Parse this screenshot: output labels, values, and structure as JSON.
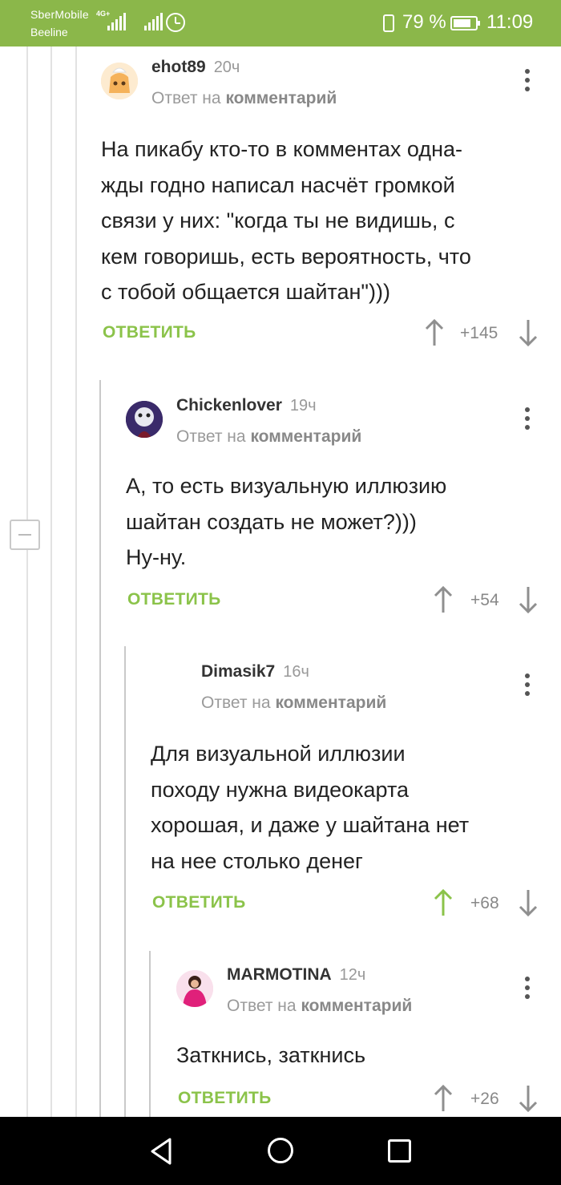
{
  "status_bar": {
    "carrier_primary": "SberMobile",
    "carrier_secondary": "Beeline",
    "network_type": "4G+",
    "battery_percent": "79 %",
    "battery_level": 0.79,
    "time": "11:09",
    "icons": [
      "signal-icon",
      "signal-icon",
      "alarm-icon",
      "vibrate-icon",
      "battery-icon"
    ]
  },
  "theme": {
    "accent": "#8bc34a",
    "status_bar": "#8bb74a",
    "vote_up_active": "#8bc34a",
    "text": "#222222",
    "muted": "#999999"
  },
  "comments": [
    {
      "username": "ehot89",
      "time": "20ч",
      "reply_prefix": "Ответ на",
      "reply_link": "комментарий",
      "text": "На пикабу кто-то в комментах одна-\nжды годно написал насчёт громкой\nсвязи у них: \"когда ты не видишь, с\nкем говоришь, есть вероятность, что\nс тобой общается шайтан\")))",
      "reply_label": "ОТВЕТИТЬ",
      "rating": "+145",
      "upvoted": false
    },
    {
      "username": "Chickenlover",
      "time": "19ч",
      "reply_prefix": "Ответ на",
      "reply_link": "комментарий",
      "text": "А, то есть визуальную иллюзию\nшайтан создать не может?)))\nНу-ну.",
      "reply_label": "ОТВЕТИТЬ",
      "rating": "+54",
      "upvoted": false
    },
    {
      "username": "Dimasik7",
      "time": "16ч",
      "reply_prefix": "Ответ на",
      "reply_link": "комментарий",
      "text": "Для визуальной иллюзии\nпоходу нужна видеокарта\nхорошая, и даже у шайтана нет\nна нее столько денег",
      "reply_label": "ОТВЕТИТЬ",
      "rating": "+68",
      "upvoted": true
    },
    {
      "username": "MARMOTINA",
      "time": "12ч",
      "reply_prefix": "Ответ на",
      "reply_link": "комментарий",
      "text": "Заткнись, заткнись",
      "reply_label": "ОТВЕТИТЬ",
      "rating": "+26",
      "upvoted": false
    }
  ],
  "nav_bar": {
    "icons": [
      "back-icon",
      "home-icon",
      "recent-apps-icon"
    ]
  }
}
